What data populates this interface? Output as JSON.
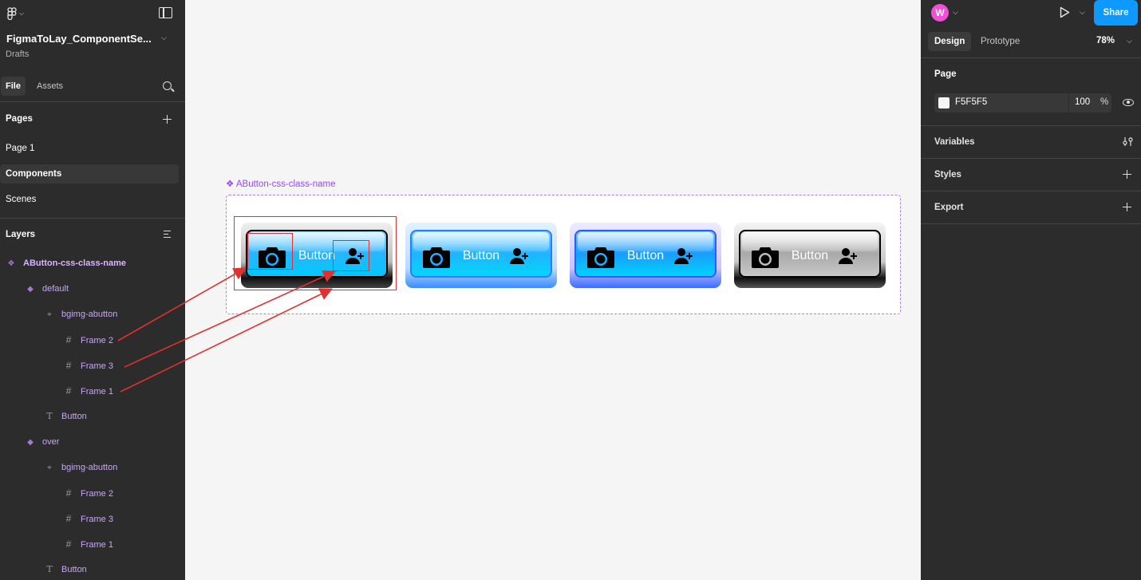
{
  "file": {
    "title": "FigmaToLay_ComponentSe...",
    "location": "Drafts"
  },
  "left_tabs": {
    "file": "File",
    "assets": "Assets"
  },
  "pages": {
    "title": "Pages",
    "items": [
      {
        "label": "Page 1"
      },
      {
        "label": "Components"
      },
      {
        "label": "Scenes"
      }
    ]
  },
  "layers": {
    "title": "Layers",
    "items": [
      {
        "label": "AButton-css-class-name"
      },
      {
        "label": "default"
      },
      {
        "label": "bgimg-abutton"
      },
      {
        "label": "Frame 2"
      },
      {
        "label": "Frame 3"
      },
      {
        "label": "Frame 1"
      },
      {
        "label": "Button"
      },
      {
        "label": "over"
      },
      {
        "label": "bgimg-abutton"
      },
      {
        "label": "Frame 2"
      },
      {
        "label": "Frame 3"
      },
      {
        "label": "Frame 1"
      },
      {
        "label": "Button"
      }
    ]
  },
  "canvas": {
    "component_label": "❖ AButton-css-class-name",
    "buttons": [
      {
        "label": "Button"
      },
      {
        "label": "Button"
      },
      {
        "label": "Button"
      },
      {
        "label": "Button"
      }
    ]
  },
  "right": {
    "avatar_letter": "W",
    "share_label": "Share",
    "tabs": {
      "design": "Design",
      "prototype": "Prototype"
    },
    "zoom": "78%",
    "page_section": "Page",
    "page_color": "F5F5F5",
    "page_opacity": "100",
    "page_opacity_unit": "%",
    "variables": "Variables",
    "styles": "Styles",
    "export": "Export"
  },
  "colors": {
    "accent": "#0d99ff",
    "component": "#9747ff",
    "annotation": "#e03030",
    "panel": "#2c2c2c"
  }
}
